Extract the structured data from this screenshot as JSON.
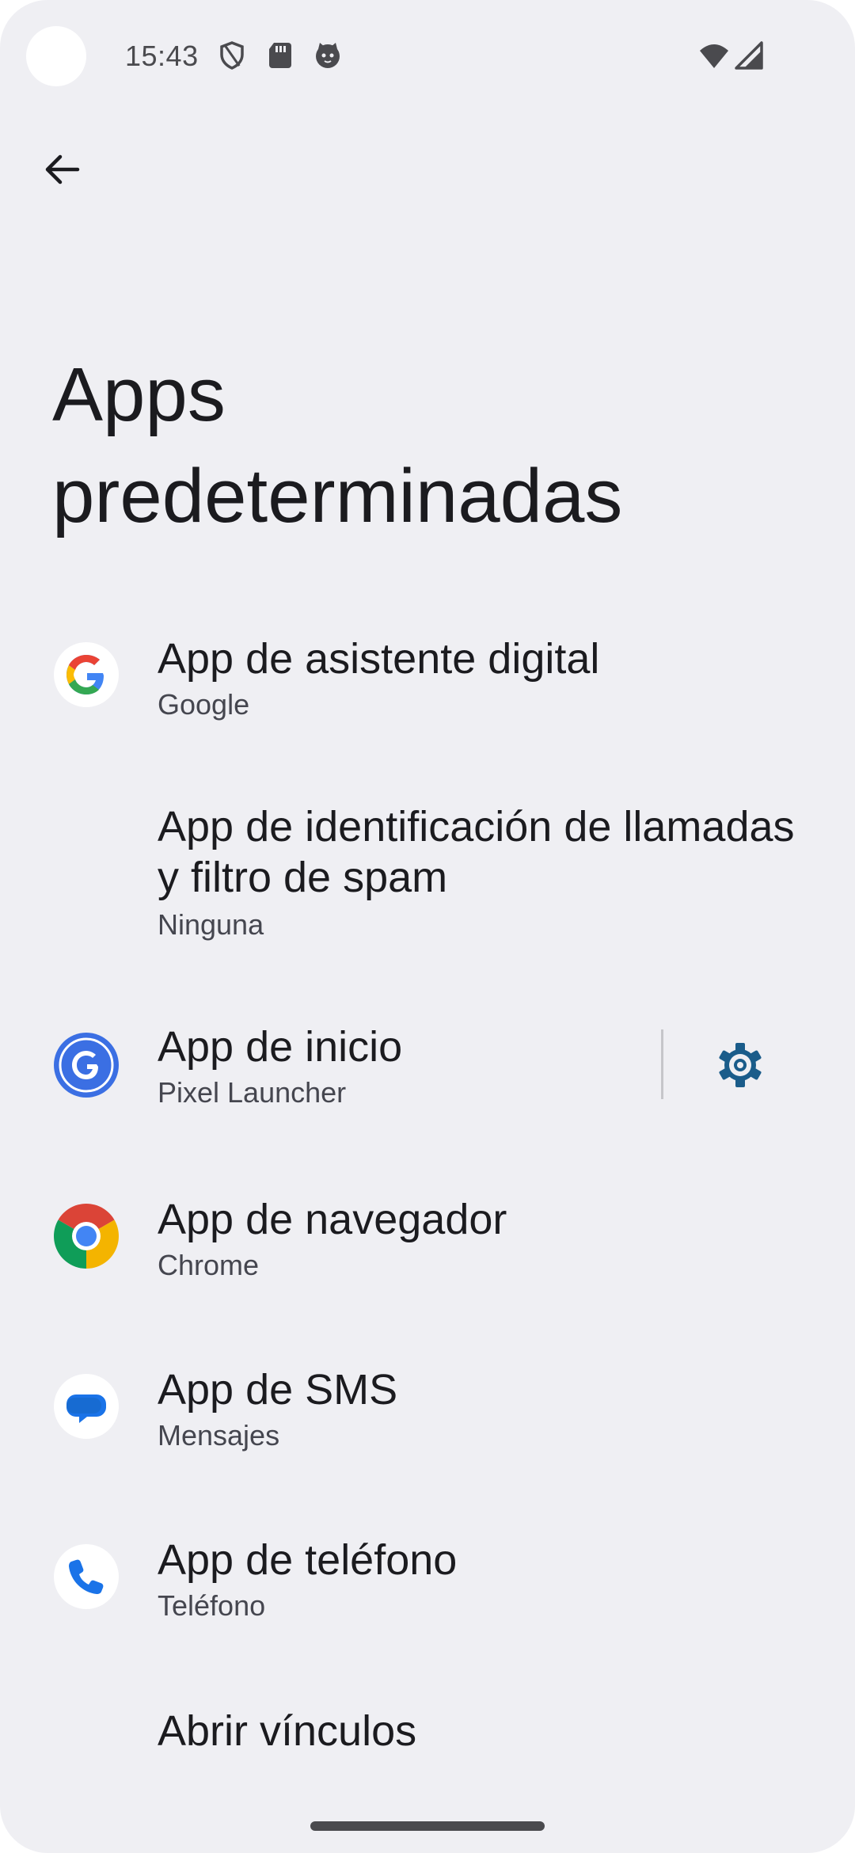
{
  "status_bar": {
    "time": "15:43",
    "icons": [
      "shield-icon",
      "sd-card-icon",
      "cat-face-icon",
      "wifi-icon",
      "cell-signal-icon"
    ]
  },
  "nav": {
    "back_icon": "arrow-left-icon"
  },
  "page": {
    "title": "Apps predeterminadas"
  },
  "items": [
    {
      "title": "App de asistente digital",
      "subtitle": "Google",
      "icon": "google-g-icon"
    },
    {
      "title": "App de identificación de llamadas y filtro de spam",
      "subtitle": "Ninguna",
      "icon": ""
    },
    {
      "title": "App de inicio",
      "subtitle": "Pixel Launcher",
      "icon": "pixel-launcher-icon",
      "action_icon": "gear-icon"
    },
    {
      "title": "App de navegador",
      "subtitle": "Chrome",
      "icon": "chrome-icon"
    },
    {
      "title": "App de SMS",
      "subtitle": "Mensajes",
      "icon": "messages-icon"
    },
    {
      "title": "App de teléfono",
      "subtitle": "Teléfono",
      "icon": "phone-icon"
    },
    {
      "title": "Abrir vínculos",
      "subtitle": "",
      "icon": ""
    }
  ],
  "colors": {
    "background": "#efeff3",
    "text_primary": "#1b1b1f",
    "text_secondary": "#45464f",
    "accent": "#1a5c8a"
  }
}
